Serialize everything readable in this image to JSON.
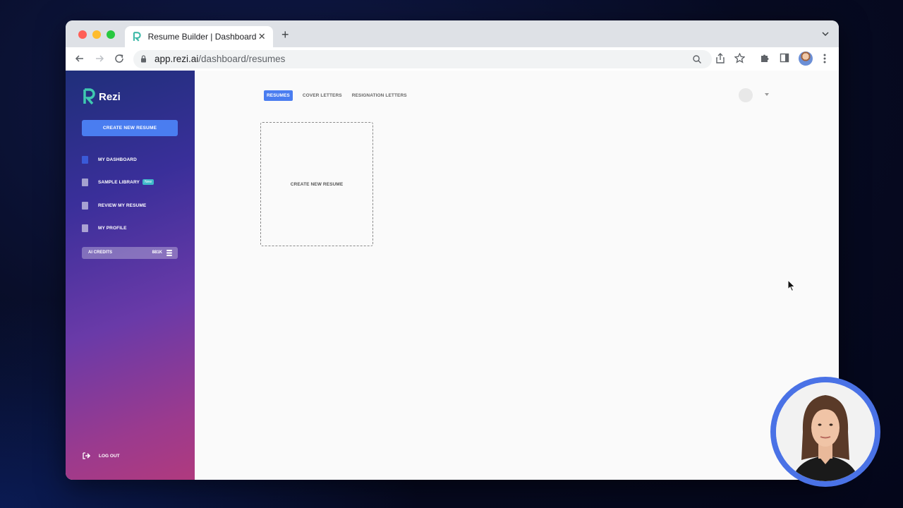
{
  "browser": {
    "tab_title": "Resume Builder | Dashboard",
    "url_domain": "app.rezi.ai",
    "url_path": "/dashboard/resumes"
  },
  "sidebar": {
    "brand": "Rezi",
    "create_button": "CREATE NEW RESUME",
    "items": [
      {
        "label": "MY DASHBOARD",
        "icon": "document-icon"
      },
      {
        "label": "SAMPLE LIBRARY",
        "icon": "library-icon",
        "badge": "New"
      },
      {
        "label": "REVIEW MY RESUME",
        "icon": "review-icon"
      },
      {
        "label": "MY PROFILE",
        "icon": "profile-icon"
      }
    ],
    "credits_label": "AI CREDITS",
    "credits_value": "881K",
    "logout": "LOG OUT"
  },
  "content": {
    "tabs": [
      {
        "label": "RESUMES",
        "active": true
      },
      {
        "label": "COVER LETTERS",
        "active": false
      },
      {
        "label": "RESIGNATION LETTERS",
        "active": false
      }
    ],
    "new_card_label": "CREATE NEW RESUME"
  },
  "colors": {
    "accent": "#4a7df0",
    "presenter_ring": "#4a72e6"
  }
}
